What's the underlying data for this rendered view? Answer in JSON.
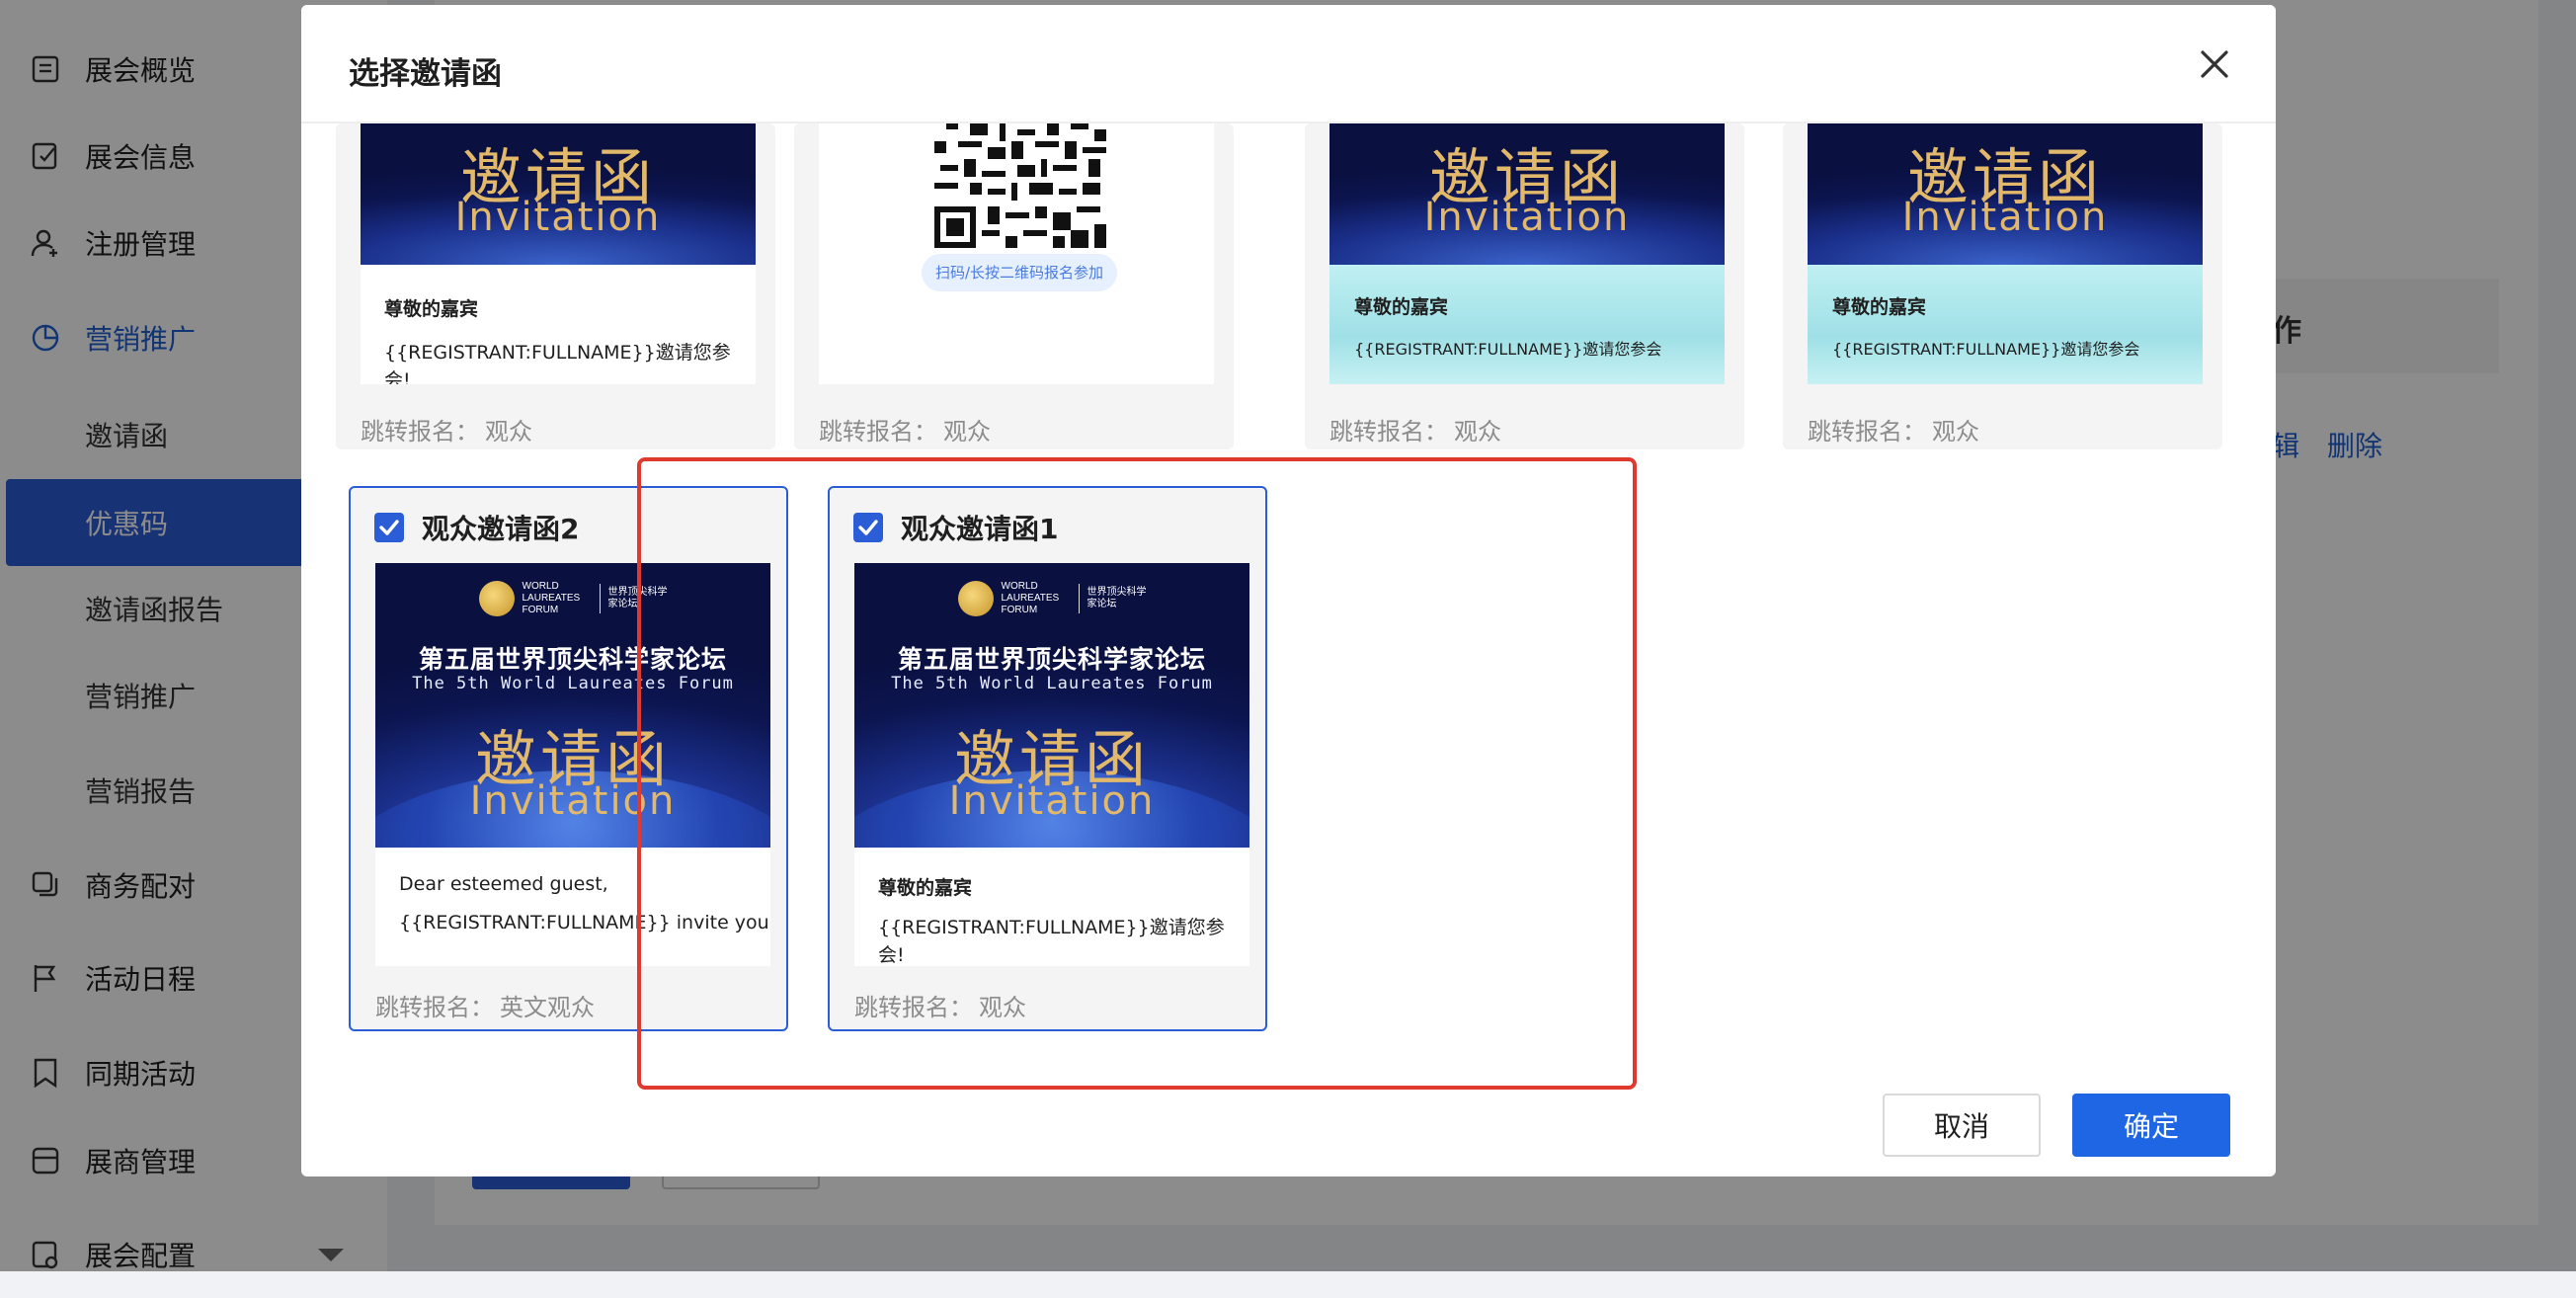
{
  "sidebar": {
    "items": [
      {
        "label": "展会概览",
        "icon": "document-list-icon"
      },
      {
        "label": "展会信息",
        "icon": "edit-document-icon"
      },
      {
        "label": "注册管理",
        "icon": "user-add-icon"
      },
      {
        "label": "营销推广",
        "icon": "pie-chart-icon"
      },
      {
        "label": "邀请函"
      },
      {
        "label": "优惠码"
      },
      {
        "label": "邀请函报告"
      },
      {
        "label": "营销推广"
      },
      {
        "label": "营销报告"
      },
      {
        "label": "商务配对",
        "icon": "copy-icon"
      },
      {
        "label": "活动日程",
        "icon": "flag-icon"
      },
      {
        "label": "同期活动",
        "icon": "bookmark-icon"
      },
      {
        "label": "展商管理",
        "icon": "store-icon"
      },
      {
        "label": "展会配置",
        "icon": "settings-icon"
      }
    ]
  },
  "background": {
    "table_header_fragment": "作",
    "links": [
      "辑",
      "删除"
    ]
  },
  "modal": {
    "title": "选择邀请函",
    "top_cards": [
      {
        "type": "banner-white",
        "greeting": "尊敬的嘉宾",
        "body": "{{REGISTRANT:FULLNAME}}邀请您参会!",
        "redirect_label": "跳转报名：",
        "redirect_value": "观众"
      },
      {
        "type": "qr",
        "qr_hint": "扫码/长按二维码报名参加",
        "redirect_label": "跳转报名：",
        "redirect_value": "观众"
      },
      {
        "type": "banner-teal",
        "greeting": "尊敬的嘉宾",
        "body": "{{REGISTRANT:FULLNAME}}邀请您参会",
        "redirect_label": "跳转报名：",
        "redirect_value": "观众"
      },
      {
        "type": "banner-teal",
        "greeting": "尊敬的嘉宾",
        "body": "{{REGISTRANT:FULLNAME}}邀请您参会",
        "redirect_label": "跳转报名：",
        "redirect_value": "观众"
      }
    ],
    "selected_cards": [
      {
        "name": "观众邀请函2",
        "checked": true,
        "greeting": "Dear esteemed guest,",
        "body": "{{REGISTRANT:FULLNAME}} invite you to",
        "redirect_label": "跳转报名：",
        "redirect_value": "英文观众"
      },
      {
        "name": "观众邀请函1",
        "checked": true,
        "greeting": "尊敬的嘉宾",
        "body": "{{REGISTRANT:FULLNAME}}邀请您参会!",
        "redirect_label": "跳转报名：",
        "redirect_value": "观众"
      }
    ],
    "banner": {
      "logo_en": "WORLD LAUREATES FORUM",
      "logo_cn": "世界顶尖科学家论坛",
      "cn_title": "第五届世界顶尖科学家论坛",
      "en_title": "The 5th World Laureates Forum",
      "big_cn": "邀请函",
      "big_en": "Invitation"
    },
    "cancel_label": "取消",
    "ok_label": "确定"
  },
  "colors": {
    "primary": "#1f66e5",
    "highlight_border": "#e03a2f",
    "sidebar_selected": "#2b5ed6"
  }
}
